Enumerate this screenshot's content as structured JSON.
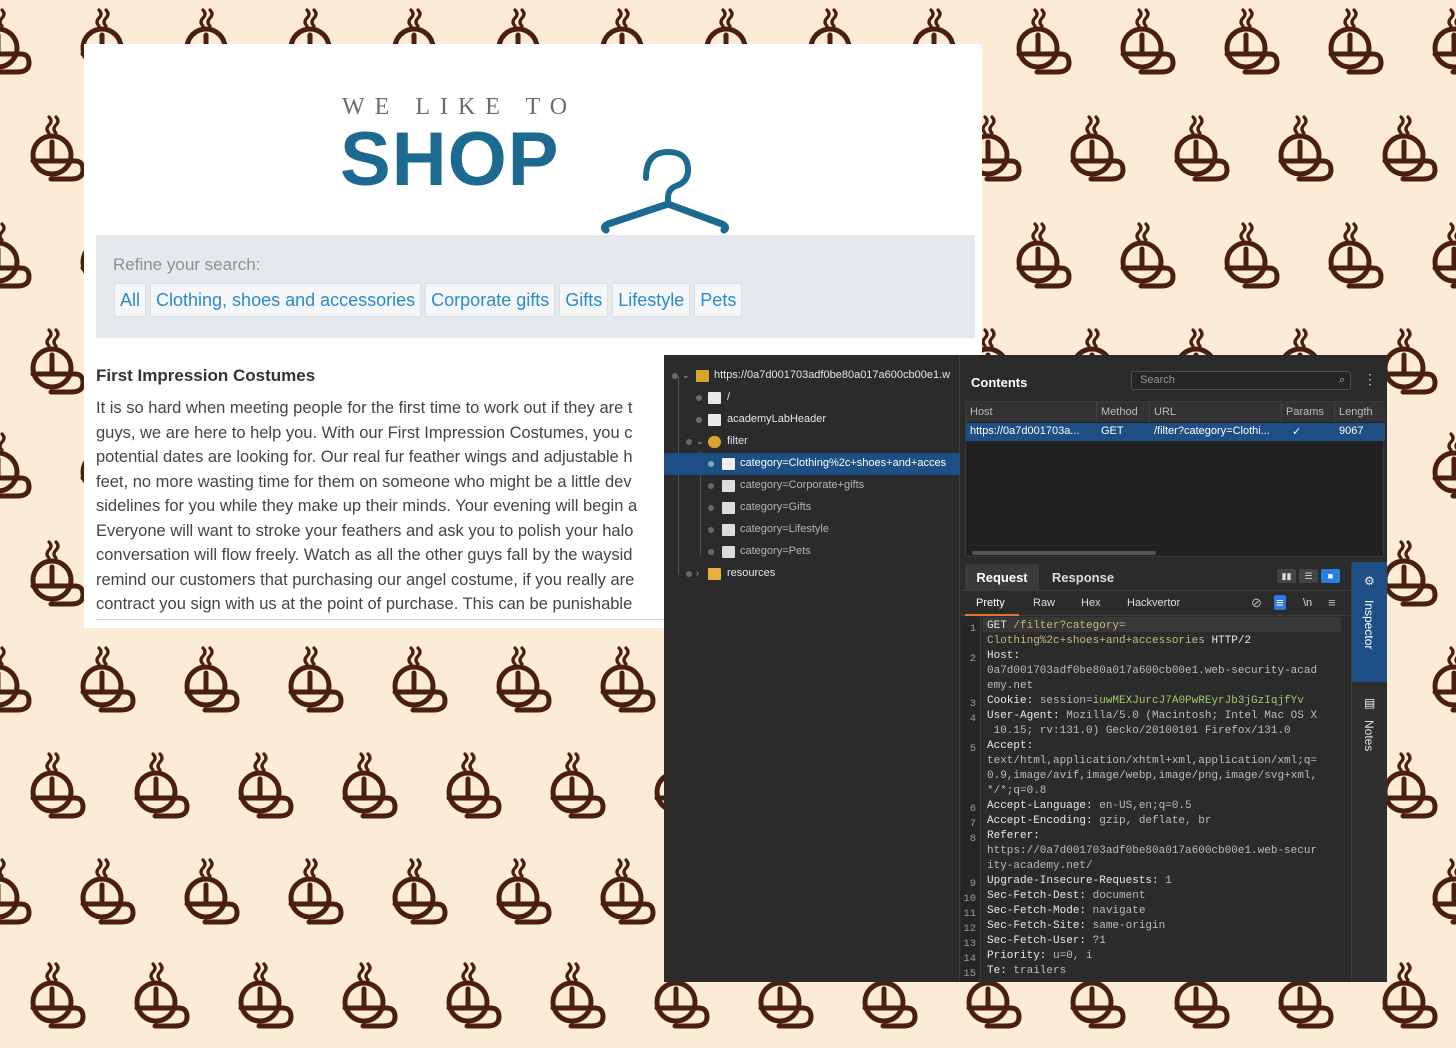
{
  "colors": {
    "background": "#fcebd6",
    "pattern_icon": "#4a1f0d",
    "shop_blue": "#1c6a8f",
    "link_blue": "#2a8bcb",
    "burp_bg": "#2b2b2b",
    "selection": "#1d4f84",
    "accent_orange": "#e8732c"
  },
  "background_icon": "coffee-cup-icon",
  "shop": {
    "tagline": "WE LIKE TO",
    "wordmark": "SHOP",
    "logo_icon": "hanger-icon",
    "filter_label": "Refine your search:",
    "categories": [
      "All",
      "Clothing, shoes and accessories",
      "Corporate gifts",
      "Gifts",
      "Lifestyle",
      "Pets"
    ],
    "product_title": "First Impression Costumes",
    "product_lines": [
      "It is so hard when meeting people for the first time to work out if they are t",
      "guys, we are here to help you. With our First Impression Costumes, you c",
      "potential dates are looking for. Our real fur feather wings and adjustable h",
      "feet, no more wasting time for them on someone who might be a little dev",
      "sidelines for you while they make up their minds. Your evening will begin a",
      "Everyone will want to stroke your feathers and ask you to polish your halo",
      "conversation will flow freely. Watch as all the other guys fall by the waysid",
      "remind our customers that purchasing our angel costume, if you really are",
      "contract you sign with us at the point of purchase. This can be punishable"
    ]
  },
  "burp": {
    "tree": {
      "root": "https://0a7d001703adf0be80a017a600cb00e1.w",
      "slash": "/",
      "header": "academyLabHeader",
      "filter": "filter",
      "items": [
        "category=Clothing%2c+shoes+and+acces",
        "category=Corporate+gifts",
        "category=Gifts",
        "category=Lifestyle",
        "category=Pets"
      ],
      "resources": "resources"
    },
    "contents": {
      "title": "Contents",
      "search_placeholder": "Search",
      "columns": [
        "Host",
        "Method",
        "URL",
        "Params",
        "Length"
      ],
      "row": {
        "host": "https://0a7d001703a...",
        "method": "GET",
        "url": "/filter?category=Clothi...",
        "params": "✓",
        "length": "9067"
      }
    },
    "tabs": {
      "request": "Request",
      "response": "Response"
    },
    "subtabs": {
      "pretty": "Pretty",
      "raw": "Raw",
      "hex": "Hex",
      "hackvertor": "Hackvertor",
      "newline": "\\n"
    },
    "request_lines": [
      {
        "n": "1",
        "parts": [
          [
            "key",
            "GET "
          ],
          [
            "path",
            "/filter?category="
          ]
        ]
      },
      {
        "n": "",
        "parts": [
          [
            "path",
            "Clothing%2c+shoes+and+accessories"
          ],
          [
            "key",
            " HTTP/2"
          ]
        ]
      },
      {
        "n": "2",
        "parts": [
          [
            "key",
            "Host:"
          ]
        ]
      },
      {
        "n": "",
        "parts": [
          [
            "val",
            "0a7d001703adf0be80a017a600cb00e1.web-security-acad"
          ]
        ]
      },
      {
        "n": "",
        "parts": [
          [
            "val",
            "emy.net"
          ]
        ]
      },
      {
        "n": "3",
        "parts": [
          [
            "key",
            "Cookie: "
          ],
          [
            "val",
            "session="
          ],
          [
            "cookie",
            "iuwMEXJurcJ7A0PwREyrJb3jGzIqjfYv"
          ]
        ]
      },
      {
        "n": "4",
        "parts": [
          [
            "key",
            "User-Agent: "
          ],
          [
            "val",
            "Mozilla/5.0 (Macintosh; Intel Mac OS X"
          ]
        ]
      },
      {
        "n": "",
        "parts": [
          [
            "val",
            " 10.15; rv:131.0) Gecko/20100101 Firefox/131.0"
          ]
        ]
      },
      {
        "n": "5",
        "parts": [
          [
            "key",
            "Accept:"
          ]
        ]
      },
      {
        "n": "",
        "parts": [
          [
            "val",
            "text/html,application/xhtml+xml,application/xml;q="
          ]
        ]
      },
      {
        "n": "",
        "parts": [
          [
            "val",
            "0.9,image/avif,image/webp,image/png,image/svg+xml,"
          ]
        ]
      },
      {
        "n": "",
        "parts": [
          [
            "val",
            "*/*;q=0.8"
          ]
        ]
      },
      {
        "n": "6",
        "parts": [
          [
            "key",
            "Accept-Language: "
          ],
          [
            "val",
            "en-US,en;q=0.5"
          ]
        ]
      },
      {
        "n": "7",
        "parts": [
          [
            "key",
            "Accept-Encoding: "
          ],
          [
            "val",
            "gzip, deflate, br"
          ]
        ]
      },
      {
        "n": "8",
        "parts": [
          [
            "key",
            "Referer:"
          ]
        ]
      },
      {
        "n": "",
        "parts": [
          [
            "val",
            "https://0a7d001703adf0be80a017a600cb00e1.web-secur"
          ]
        ]
      },
      {
        "n": "",
        "parts": [
          [
            "val",
            "ity-academy.net/"
          ]
        ]
      },
      {
        "n": "9",
        "parts": [
          [
            "key",
            "Upgrade-Insecure-Requests: "
          ],
          [
            "val",
            "1"
          ]
        ]
      },
      {
        "n": "10",
        "parts": [
          [
            "key",
            "Sec-Fetch-Dest: "
          ],
          [
            "val",
            "document"
          ]
        ]
      },
      {
        "n": "11",
        "parts": [
          [
            "key",
            "Sec-Fetch-Mode: "
          ],
          [
            "val",
            "navigate"
          ]
        ]
      },
      {
        "n": "12",
        "parts": [
          [
            "key",
            "Sec-Fetch-Site: "
          ],
          [
            "val",
            "same-origin"
          ]
        ]
      },
      {
        "n": "13",
        "parts": [
          [
            "key",
            "Sec-Fetch-User: "
          ],
          [
            "val",
            "?1"
          ]
        ]
      },
      {
        "n": "14",
        "parts": [
          [
            "key",
            "Priority: "
          ],
          [
            "val",
            "u=0, i"
          ]
        ]
      },
      {
        "n": "15",
        "parts": [
          [
            "key",
            "Te: "
          ],
          [
            "val",
            "trailers"
          ]
        ]
      }
    ],
    "sidebar": {
      "inspector": "Inspector",
      "notes": "Notes"
    }
  }
}
